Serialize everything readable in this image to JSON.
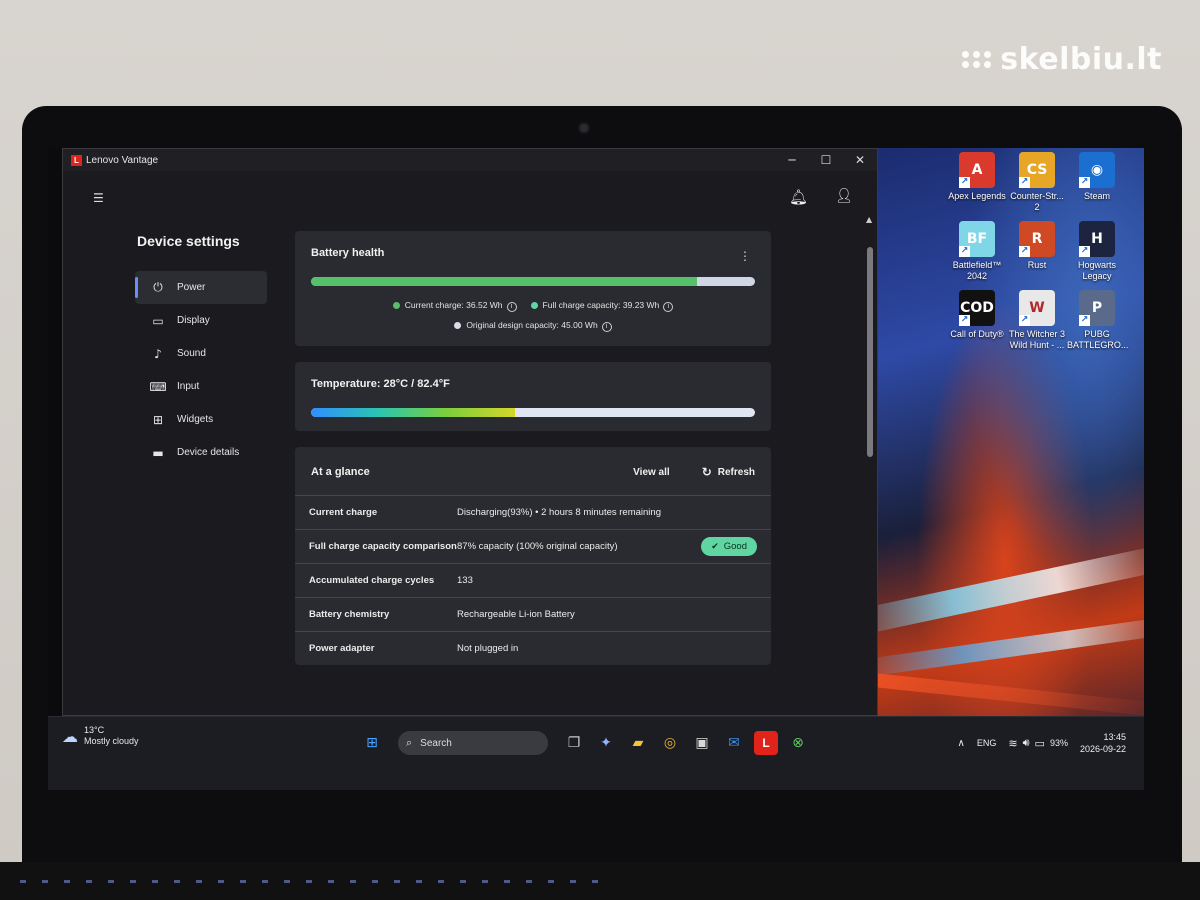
{
  "watermark": {
    "text": "skelbiu.lt"
  },
  "window": {
    "title": "Lenovo Vantage",
    "logo_letter": "L"
  },
  "sidebar": {
    "title": "Device settings",
    "items": [
      {
        "label": "Power",
        "icon": "plug-icon",
        "active": true
      },
      {
        "label": "Display",
        "icon": "monitor-icon"
      },
      {
        "label": "Sound",
        "icon": "music-note-icon"
      },
      {
        "label": "Input",
        "icon": "keyboard-icon"
      },
      {
        "label": "Widgets",
        "icon": "widgets-icon"
      },
      {
        "label": "Device details",
        "icon": "laptop-icon"
      }
    ]
  },
  "battery_health": {
    "title": "Battery health",
    "current_fraction": 0.87,
    "current_label": "Current charge:",
    "current_value": "36.52 Wh",
    "full_label": "Full charge capacity:",
    "full_value": "39.23 Wh",
    "design_label": "Original design capacity:",
    "design_value": "45.00 Wh"
  },
  "temperature": {
    "label": "Temperature:",
    "value": "28°C / 82.4°F",
    "level_fraction": 0.46
  },
  "glance": {
    "title": "At a glance",
    "view_all": "View all",
    "refresh": "Refresh",
    "rows": [
      {
        "key": "Current charge",
        "value": "Discharging(93%)  •  2 hours 8 minutes remaining"
      },
      {
        "key": "Full charge capacity comparison",
        "value": "87% capacity (100% original capacity)",
        "badge": "Good"
      },
      {
        "key": "Accumulated charge cycles",
        "value": "133"
      },
      {
        "key": "Battery chemistry",
        "value": "Rechargeable Li-ion Battery"
      },
      {
        "key": "Power adapter",
        "value": "Not plugged in"
      }
    ]
  },
  "desktop_icons": [
    {
      "label": "Apex Legends",
      "icon": "apex-icon",
      "color": "#d93a2b",
      "glyph": "A"
    },
    {
      "label": "Counter-Str... 2",
      "icon": "cs2-icon",
      "color": "#e8a626",
      "glyph": "CS"
    },
    {
      "label": "Steam",
      "icon": "steam-icon",
      "color": "#1b6fd0",
      "glyph": "◉"
    },
    {
      "label": "Battlefield™ 2042",
      "icon": "battlefield-icon",
      "color": "#7fd6e6",
      "glyph": "BF"
    },
    {
      "label": "Rust",
      "icon": "rust-icon",
      "color": "#cf4a24",
      "glyph": "R"
    },
    {
      "label": "Hogwarts Legacy",
      "icon": "hogwarts-icon",
      "color": "#1d2440",
      "glyph": "H"
    },
    {
      "label": "Call of Duty®",
      "icon": "cod-icon",
      "color": "#111111",
      "glyph": "COD"
    },
    {
      "label": "The Witcher 3 Wild Hunt - ...",
      "icon": "witcher-icon",
      "color": "#e8e8e8",
      "glyph": "W"
    },
    {
      "label": "PUBG BATTLEGRO...",
      "icon": "pubg-icon",
      "color": "#5a6a8a",
      "glyph": "P"
    }
  ],
  "taskbar": {
    "weather_temp": "13°C",
    "weather_desc": "Mostly cloudy",
    "search_placeholder": "Search",
    "language": "ENG",
    "battery": "93%",
    "time": "13:45",
    "date": "2026-09-22",
    "vantage_letter": "L"
  },
  "colors": {
    "accent": "#6b8cff",
    "battery_fill": "#55c06a",
    "good_badge": "#5fd6a1",
    "vantage_red": "#e2231a"
  }
}
